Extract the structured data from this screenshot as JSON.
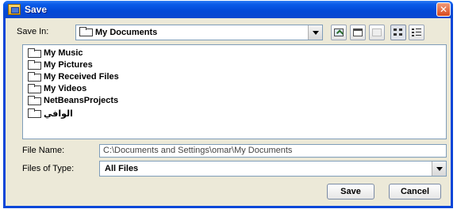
{
  "window": {
    "title": "Save",
    "icon": "java-window-icon",
    "close_icon": "close-icon"
  },
  "toolbar": {
    "save_in_label": "Save In:",
    "save_in_value": "My Documents",
    "buttons": [
      "up-one-level-icon",
      "home-icon",
      "new-folder-icon",
      "list-view-icon",
      "details-view-icon"
    ]
  },
  "files": [
    {
      "name": "My Music"
    },
    {
      "name": "My Pictures"
    },
    {
      "name": "My Received Files"
    },
    {
      "name": "My Videos"
    },
    {
      "name": "NetBeansProjects"
    },
    {
      "name": "الوافي"
    }
  ],
  "file_name": {
    "label": "File Name:",
    "value": "C:\\Documents and Settings\\omar\\My Documents"
  },
  "file_type": {
    "label": "Files of Type:",
    "value": "All Files"
  },
  "buttons": {
    "save": "Save",
    "cancel": "Cancel"
  },
  "colors": {
    "title_bar": "#0349d6",
    "dialog_bg": "#ece9d8",
    "close": "#d94b1e",
    "field_border": "#7f9db9"
  }
}
